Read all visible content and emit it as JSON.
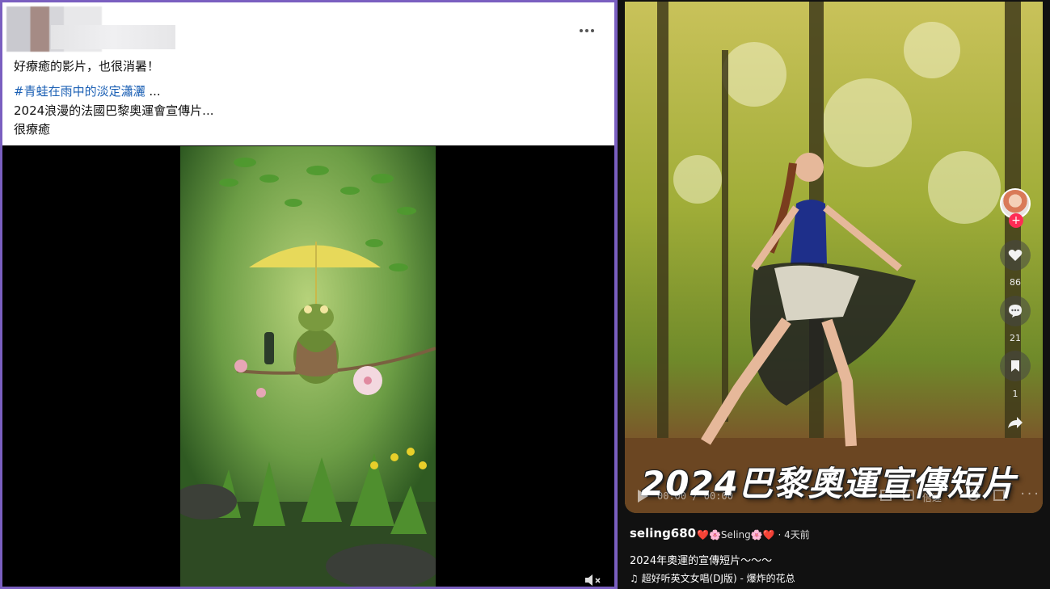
{
  "post": {
    "line1": "好療癒的影片，也很消暑！",
    "hashtag": "#青蛙在雨中的淡定瀟灑",
    "hashtag_suffix": " ...",
    "line3": "2024浪漫的法國巴黎奧運會宣傳片...",
    "line4": "很療癒",
    "more_icon": "more-horizontal-icon",
    "mute_icon": "volume-muted-icon"
  },
  "tiktok": {
    "overlay_title": "2024巴黎奧運宣傳短片",
    "time": "00:00 / 00:00",
    "speed": "倍速",
    "likes": "86",
    "comments": "21",
    "saves": "1",
    "username": "seling680",
    "nickname": "❤️🌸Seling🌸❤️",
    "time_ago": "· 4天前",
    "caption": "2024年奧運的宣傳短片～～～",
    "music": "♫ 超好听英文女唱(DJ版) - 爆炸的花总",
    "colors": {
      "follow": "#fe2c55",
      "panel": "#111111"
    }
  }
}
